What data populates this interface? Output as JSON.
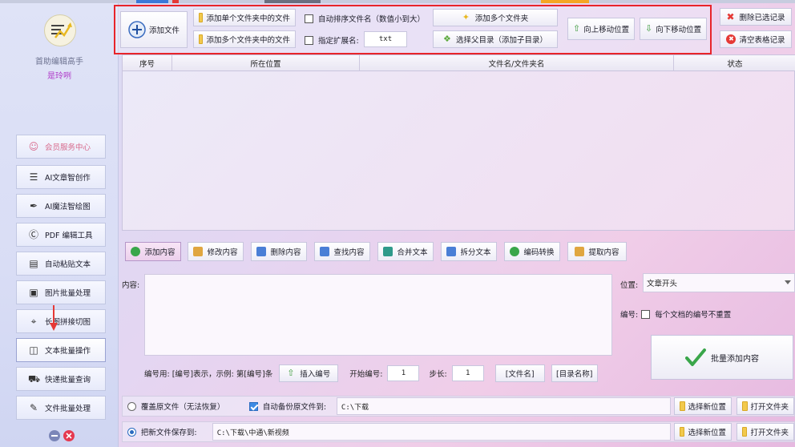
{
  "sidebar": {
    "app_title": "首助编辑高手",
    "user": "是玲咧",
    "items": [
      {
        "label": "会员服务中心",
        "icon": "user-icon"
      },
      {
        "label": "AI文章智创作",
        "icon": "menu-lines-icon"
      },
      {
        "label": "AI魔法智绘图",
        "icon": "brush-icon"
      },
      {
        "label": "PDF 编辑工具",
        "icon": "pdf-icon"
      },
      {
        "label": "自动粘贴文本",
        "icon": "paste-icon"
      },
      {
        "label": "图片批量处理",
        "icon": "image-icon"
      },
      {
        "label": "长图拼接切图",
        "icon": "crop-icon"
      },
      {
        "label": "文本批量操作",
        "icon": "text-icon"
      },
      {
        "label": "快递批量查询",
        "icon": "truck-icon"
      },
      {
        "label": "文件批量处理",
        "icon": "file-edit-icon"
      }
    ]
  },
  "toolbar": {
    "add_file": "添加文件",
    "add_single_folder_files": "添加单个文件夹中的文件",
    "add_multi_folder_files": "添加多个文件夹中的文件",
    "auto_sort": "自动排序文件名（数值小到大）",
    "specify_ext": "指定扩展名:",
    "ext_value": "txt",
    "add_multi_folders": "添加多个文件夹",
    "select_parent": "选择父目录（添加子目录）",
    "move_up": "向上移动位置",
    "move_down": "向下移动位置",
    "delete_selected": "删除已选记录",
    "clear_table": "清空表格记录"
  },
  "table": {
    "columns": [
      "序号",
      "所在位置",
      "文件名/文件夹名",
      "状态"
    ]
  },
  "tabs": [
    {
      "label": "添加内容",
      "icon": "add-circle-icon",
      "color": "#3aa64a"
    },
    {
      "label": "修改内容",
      "icon": "edit-doc-icon",
      "color": "#e0a640"
    },
    {
      "label": "删除内容",
      "icon": "delete-doc-icon",
      "color": "#4a7fd6"
    },
    {
      "label": "查找内容",
      "icon": "find-doc-icon",
      "color": "#4a7fd6"
    },
    {
      "label": "合并文本",
      "icon": "merge-icon",
      "color": "#2f9a8a"
    },
    {
      "label": "拆分文本",
      "icon": "split-icon",
      "color": "#4a7fd6"
    },
    {
      "label": "编码转换",
      "icon": "convert-icon",
      "color": "#3aa64a"
    },
    {
      "label": "提取内容",
      "icon": "extract-icon",
      "color": "#e0a640"
    }
  ],
  "content": {
    "label": "内容:",
    "value": "",
    "position_label": "位置:",
    "position_value": "文章开头",
    "number_label": "编号:",
    "number_option": "每个文档的编号不重置",
    "batch_add": "批量添加内容"
  },
  "numbering": {
    "hint": "编号用: [编号]表示，示例: 第[编号]条",
    "insert": "插入编号",
    "start_label": "开始编号:",
    "start_value": "1",
    "step_label": "步长:",
    "step_value": "1",
    "file_name_tag": "[文件名]",
    "dir_name_tag": "[目录名称]"
  },
  "output": {
    "overwrite": "覆盖原文件（无法恢复）",
    "auto_backup": "自动备份原文件到:",
    "backup_path": "C:\\下载",
    "select_new_pos": "选择新位置",
    "open_folder": "打开文件夹",
    "save_new_to": "把新文件保存到:",
    "save_path": "C:\\下载\\中通\\新视频"
  },
  "colors": {
    "accent_red": "#e8242a",
    "check_blue": "#3d8ae4",
    "member_pink": "#d86b8c"
  }
}
